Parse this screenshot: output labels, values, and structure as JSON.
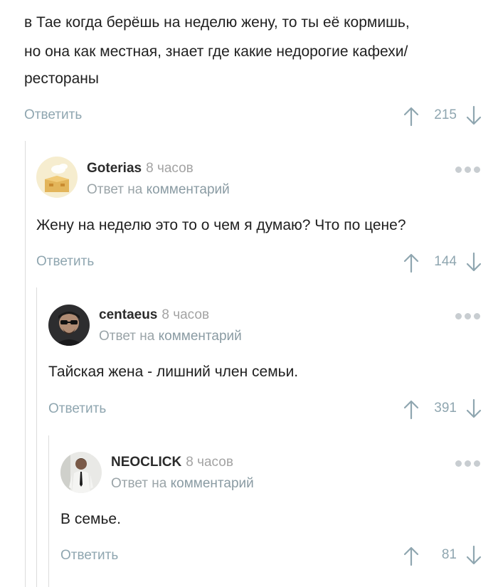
{
  "top_comment": {
    "lines": [
      "в Тае когда берёшь на неделю жену, то ты её кормишь,",
      "но она как местная, знает где какие недорогие кафехи/",
      "рестораны"
    ],
    "reply_label": "Ответить",
    "rating": "215"
  },
  "replies": [
    {
      "author": "Goterias",
      "time": "8 часов",
      "reply_prefix": "Ответ на",
      "reply_target": "комментарий",
      "text": "Жену на неделю это то о чем я думаю? Что по цене?",
      "reply_label": "Ответить",
      "rating": "144"
    },
    {
      "author": "centaeus",
      "time": "8 часов",
      "reply_prefix": "Ответ на",
      "reply_target": "комментарий",
      "text": "Тайская жена - лишний член семьи.",
      "reply_label": "Ответить",
      "rating": "391"
    },
    {
      "author": "NEOCLICK",
      "time": "8 часов",
      "reply_prefix": "Ответ на",
      "reply_target": "комментарий",
      "text": "В семье.",
      "reply_label": "Ответить",
      "rating": "81"
    }
  ],
  "icons": {
    "vote_up": "arrow-up-icon",
    "vote_down": "arrow-down-icon",
    "more": "more-dots-icon"
  },
  "colors": {
    "link": "#8fa6b0",
    "text": "#1f1f1f",
    "muted": "#a3a3a3",
    "thread_line": "#dcdcdc"
  }
}
